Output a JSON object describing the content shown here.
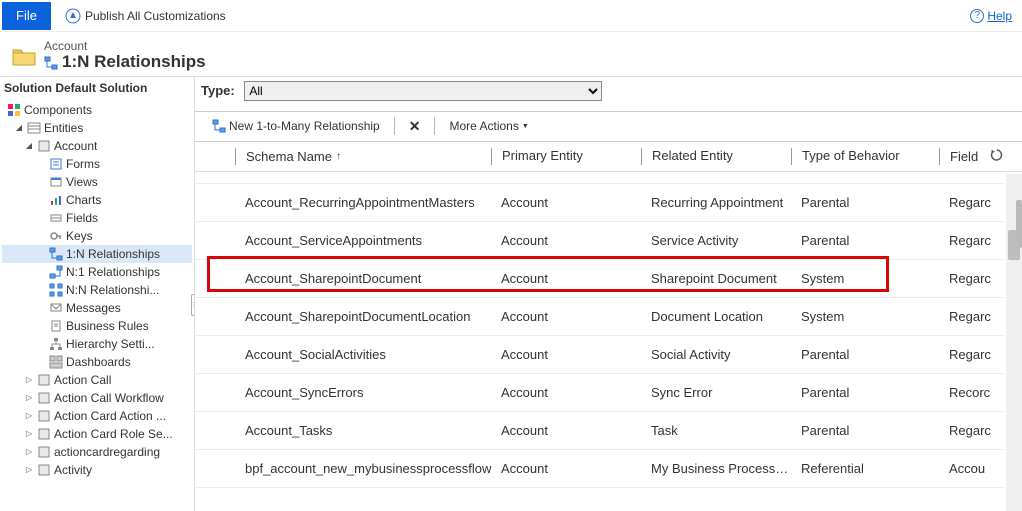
{
  "topbar": {
    "file": "File",
    "publish": "Publish All Customizations",
    "help": "Help"
  },
  "header": {
    "parent": "Account",
    "title": "1:N Relationships"
  },
  "sidebar": {
    "title": "Solution Default Solution",
    "components": "Components",
    "entities": "Entities",
    "account": "Account",
    "account_children": [
      "Forms",
      "Views",
      "Charts",
      "Fields",
      "Keys",
      "1:N Relationships",
      "N:1 Relationships",
      "N:N Relationshi...",
      "Messages",
      "Business Rules",
      "Hierarchy Setti...",
      "Dashboards"
    ],
    "other": [
      "Action Call",
      "Action Call Workflow",
      "Action Card Action ...",
      "Action Card Role Se...",
      "actioncardregarding",
      "Activity"
    ]
  },
  "typebar": {
    "label": "Type:",
    "selected": "All"
  },
  "toolbar": {
    "new": "New 1-to-Many Relationship",
    "more": "More Actions"
  },
  "columns": {
    "schema": "Schema Name",
    "primary": "Primary Entity",
    "related": "Related Entity",
    "behavior": "Type of Behavior",
    "field": "Field"
  },
  "chart_data": {
    "type": "table",
    "columns": [
      "Schema Name",
      "Primary Entity",
      "Related Entity",
      "Type of Behavior",
      "Field"
    ],
    "rows": [
      {
        "schema": "Account_RecurringAppointmentMasters",
        "primary": "Account",
        "related": "Recurring Appointment",
        "behavior": "Parental",
        "field": "Regarc"
      },
      {
        "schema": "Account_ServiceAppointments",
        "primary": "Account",
        "related": "Service Activity",
        "behavior": "Parental",
        "field": "Regarc"
      },
      {
        "schema": "Account_SharepointDocument",
        "primary": "Account",
        "related": "Sharepoint Document",
        "behavior": "System",
        "field": "Regarc"
      },
      {
        "schema": "Account_SharepointDocumentLocation",
        "primary": "Account",
        "related": "Document Location",
        "behavior": "System",
        "field": "Regarc"
      },
      {
        "schema": "Account_SocialActivities",
        "primary": "Account",
        "related": "Social Activity",
        "behavior": "Parental",
        "field": "Regarc"
      },
      {
        "schema": "Account_SyncErrors",
        "primary": "Account",
        "related": "Sync Error",
        "behavior": "Parental",
        "field": "Recorc"
      },
      {
        "schema": "Account_Tasks",
        "primary": "Account",
        "related": "Task",
        "behavior": "Parental",
        "field": "Regarc"
      },
      {
        "schema": "bpf_account_new_mybusinessprocessflow",
        "primary": "Account",
        "related": "My Business Process F...",
        "behavior": "Referential",
        "field": "Accou"
      }
    ]
  },
  "highlight_row_index": 2
}
